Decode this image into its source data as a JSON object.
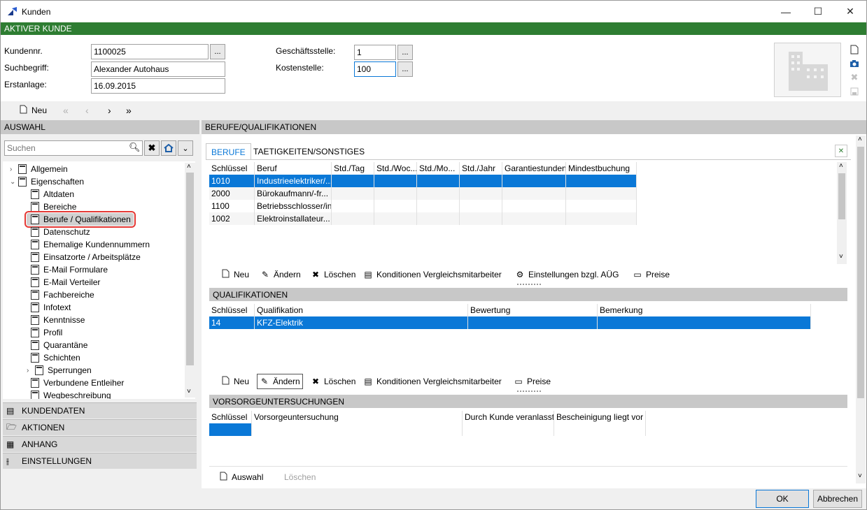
{
  "window": {
    "title": "Kunden",
    "minimize": "—",
    "maximize": "☐",
    "close": "✕"
  },
  "status_bar": "AKTIVER KUNDE",
  "header": {
    "kundennr_label": "Kundennr.",
    "kundennr_value": "1100025",
    "suchbegriff_label": "Suchbegriff:",
    "suchbegriff_value": "Alexander Autohaus",
    "erstanlage_label": "Erstanlage:",
    "erstanlage_value": "16.09.2015",
    "geschaeftsstelle_label": "Geschäftsstelle:",
    "geschaeftsstelle_value": "1",
    "kostenstelle_label": "Kostenstelle:",
    "kostenstelle_value": "100",
    "dots": "..."
  },
  "nav": {
    "neu": "Neu",
    "first": "«",
    "prev": "‹",
    "next": "›",
    "last": "»"
  },
  "left": {
    "title": "AUSWAHL",
    "search_placeholder": "Suchen",
    "tree": [
      {
        "label": "Allgemein",
        "level": 0,
        "exp": "›"
      },
      {
        "label": "Eigenschaften",
        "level": 0,
        "exp": "⌄"
      },
      {
        "label": "Altdaten",
        "level": 1
      },
      {
        "label": "Bereiche",
        "level": 1
      },
      {
        "label": "Berufe / Qualifikationen",
        "level": 1
      },
      {
        "label": "Datenschutz",
        "level": 1
      },
      {
        "label": "Ehemalige Kundennummern",
        "level": 1
      },
      {
        "label": "Einsatzorte / Arbeitsplätze",
        "level": 1
      },
      {
        "label": "E-Mail Formulare",
        "level": 1
      },
      {
        "label": "E-Mail Verteiler",
        "level": 1
      },
      {
        "label": "Fachbereiche",
        "level": 1
      },
      {
        "label": "Infotext",
        "level": 1
      },
      {
        "label": "Kenntnisse",
        "level": 1
      },
      {
        "label": "Profil",
        "level": 1
      },
      {
        "label": "Quarantäne",
        "level": 1
      },
      {
        "label": "Schichten",
        "level": 1
      },
      {
        "label": "Sperrungen",
        "level": 1,
        "exp": "›"
      },
      {
        "label": "Verbundene Entleiher",
        "level": 1
      },
      {
        "label": "Wegbeschreibung",
        "level": 1
      }
    ],
    "sections": [
      "KUNDENDATEN",
      "AKTIONEN",
      "ANHANG",
      "EINSTELLUNGEN"
    ]
  },
  "right": {
    "title": "BERUFE/QUALIFIKATIONEN",
    "tabs": [
      "BERUFE",
      "TAETIGKEITEN/SONSTIGES"
    ],
    "berufe": {
      "headers": [
        "Schlüssel",
        "Beruf",
        "Std./Tag",
        "Std./Woc...",
        "Std./Mo...",
        "Std./Jahr",
        "Garantiestunden",
        "Mindestbuchung"
      ],
      "rows": [
        [
          "1010",
          "Industrieelektriker/...",
          "",
          "",
          "",
          "",
          "",
          ""
        ],
        [
          "2000",
          "Bürokaufmann/-fr...",
          "",
          "",
          "",
          "",
          "",
          ""
        ],
        [
          "1100",
          "Betriebsschlosser/in",
          "",
          "",
          "",
          "",
          "",
          ""
        ],
        [
          "1002",
          "Elektroinstallateur...",
          "",
          "",
          "",
          "",
          "",
          ""
        ]
      ]
    },
    "toolbar1": [
      "Neu",
      "Ändern",
      "Löschen",
      "Konditionen Vergleichsmitarbeiter",
      "Einstellungen bzgl. AÜG",
      "Preise"
    ],
    "qual_title": "QUALIFIKATIONEN",
    "qual": {
      "headers": [
        "Schlüssel",
        "Qualifikation",
        "Bewertung",
        "Bemerkung"
      ],
      "rows": [
        [
          "14",
          "KFZ-Elektrik",
          "",
          ""
        ]
      ]
    },
    "toolbar2": [
      "Neu",
      "Ändern",
      "Löschen",
      "Konditionen Vergleichsmitarbeiter",
      "Preise"
    ],
    "vorsorge_title": "VORSORGEUNTERSUCHUNGEN",
    "vorsorge": {
      "headers": [
        "Schlüssel",
        "Vorsorgeuntersuchung",
        "Durch Kunde veranlasst",
        "Bescheinigung liegt vor"
      ]
    },
    "toolbar3": [
      "Auswahl",
      "Löschen"
    ]
  },
  "footer": {
    "ok": "OK",
    "cancel": "Abbrechen"
  },
  "colors": {
    "green": "#2e7d32",
    "selection": "#0a78d7",
    "highlight": "#e53935"
  }
}
